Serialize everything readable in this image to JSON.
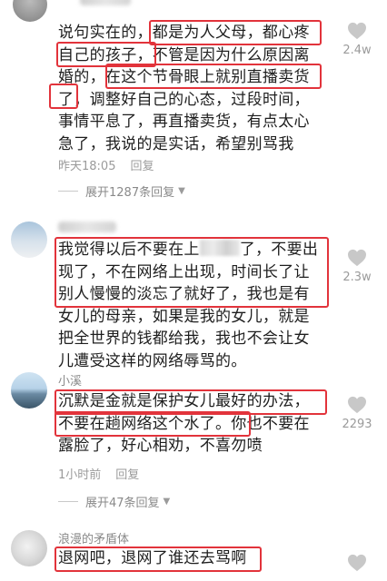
{
  "comments": [
    {
      "username": "",
      "lines": [
        "说句实在的，都是为人父母，都心疼",
        "自己的孩子，不管是因为什么原因离",
        "婚的，在这个节骨眼上就别直播卖货",
        "了，调整好自己的心态，过段时间，",
        "事情平息了，再直播卖货，有点太心",
        "急了，我说的是实话，希望别骂我"
      ],
      "time": "昨天18:05",
      "reply_label": "回复",
      "expand_label": "展开1287条回复",
      "likes": "2.4w"
    },
    {
      "username": "",
      "lines_a": "我觉得以后不要在上",
      "lines_b": "了，不要出",
      "lines": [
        "现了，不在网络上出现，时间长了让",
        "别人慢慢的淡忘了就好了，我也是有",
        "女儿的母亲，如果是我的女儿，就是",
        "把全世界的钱都给我，我也不会让女",
        "儿遭受这样的网络辱骂的。"
      ],
      "likes": "2.3w"
    },
    {
      "username": "小溪",
      "lines": [
        "沉默是金就是保护女儿最好的办法，",
        "不要在趟网络这个水了。你也不要在",
        "露脸了，好心相劝，不喜勿喷"
      ],
      "time": "1小时前",
      "reply_label": "回复",
      "expand_label": "展开47条回复",
      "likes": "2293"
    },
    {
      "username": "浪漫的矛盾体",
      "lines": [
        "退网吧，退网了谁还去骂啊"
      ]
    }
  ],
  "colors": {
    "highlight_box": "#e2333b",
    "meta": "#9b9b9b"
  }
}
